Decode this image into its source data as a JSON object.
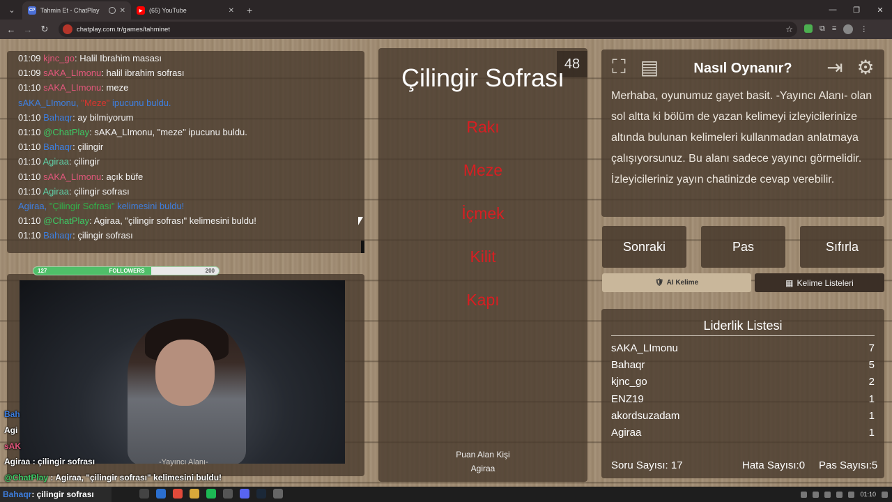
{
  "browser": {
    "tabs": [
      {
        "label": "Tahmin Et - ChatPlay",
        "favicon": "CP"
      },
      {
        "label": "(65) YouTube",
        "favicon": "yt"
      }
    ],
    "url": "chatplay.com.tr/games/tahminet"
  },
  "chat": {
    "lines": [
      {
        "time": "01:09",
        "user": "kjnc_go",
        "user_color": "#e0577b",
        "text": "Halil Ibrahim masası"
      },
      {
        "time": "01:09",
        "user": "sAKA_LImonu",
        "user_color": "#e0577b",
        "text": "halil ibrahim sofrası"
      },
      {
        "time": "01:10",
        "user": "sAKA_LImonu",
        "user_color": "#e0577b",
        "text": "meze"
      },
      {
        "system": true,
        "pre": "sAKA_LImonu, ",
        "quote": "\"Meze\"",
        "post": " ipucunu buldu."
      },
      {
        "time": "01:10",
        "user": "Bahaqr",
        "user_color": "#3e7fe0",
        "text": "ay bilmiyorum"
      },
      {
        "time": "01:10",
        "user": "@ChatPlay",
        "user_color": "#3ccb65",
        "text": "sAKA_LImonu, \"meze\" ipucunu buldu."
      },
      {
        "time": "01:10",
        "user": "Bahaqr",
        "user_color": "#3e7fe0",
        "text": "çilingir"
      },
      {
        "time": "01:10",
        "user": "Agiraa",
        "user_color": "#5fd0a8",
        "text": "çilingir"
      },
      {
        "time": "01:10",
        "user": "sAKA_LImonu",
        "user_color": "#e0577b",
        "text": "açık büfe"
      },
      {
        "time": "01:10",
        "user": "Agiraa",
        "user_color": "#5fd0a8",
        "text": "çilingir sofrası"
      },
      {
        "system": true,
        "green": true,
        "pre": "Agiraa, ",
        "quote": "\"Çilingir Sofrası\"",
        "post": " kelimesini buldu!"
      },
      {
        "time": "01:10",
        "user": "@ChatPlay",
        "user_color": "#3ccb65",
        "text": "Agiraa, \"çilingir sofrası\" kelimesini buldu!"
      },
      {
        "time": "01:10",
        "user": "Bahaqr",
        "user_color": "#3e7fe0",
        "text": "çilingir sofrası"
      }
    ]
  },
  "followers": {
    "current": "127",
    "label": "FOLLOWERS",
    "goal": "200",
    "progress": 0.635
  },
  "stream_overlay": {
    "chat": [
      {
        "user": "Bah",
        "color": "#3e7fe0",
        "text": ""
      },
      {
        "user": "Agi",
        "color": "#ffffff",
        "text": ""
      },
      {
        "user": "sAK",
        "color": "#e0577b",
        "text": ""
      },
      {
        "user": "Agiraa",
        "color": "#ffffff",
        "text": " : çilingir sofrası"
      },
      {
        "user": "@ChatPlay",
        "color": "#3ccb65",
        "text": " : Agiraa, \"çilingir sofrası\" kelimesini buldu!"
      },
      {
        "user": "Bahaqr",
        "color": "#3e7fe0",
        "text": " : çilingir sofrası"
      }
    ],
    "yayinci_label": "-Yayıncı Alanı-"
  },
  "game": {
    "word": "Çilingir Sofrası",
    "timer": "48",
    "taboo_words": [
      "Rakı",
      "Meze",
      "İçmek",
      "Kilit",
      "Kapı"
    ],
    "taboo_color": "#d81e22",
    "scorer_label": "Puan Alan Kişi",
    "scorer_name": "Agiraa"
  },
  "howto": {
    "title": "Nasıl Oynanır?",
    "text": "Merhaba, oyunumuz gayet basit. -Yayıncı Alanı- olan sol altta ki bölüm de yazan kelimeyi izleyicilerinize altında bulunan kelimeleri kullanmadan anlatmaya çalışıyorsunuz. Bu alanı sadece yayıncı görmelidir. İzleyicileriniz yayın chatinizde cevap verebilir."
  },
  "buttons": {
    "next": "Sonraki",
    "pass": "Pas",
    "reset": "Sıfırla",
    "ai_word": "AI Kelime",
    "word_lists": "Kelime Listeleri"
  },
  "leaderboard": {
    "title": "Liderlik Listesi",
    "rows": [
      {
        "name": "sAKA_LImonu",
        "score": "7"
      },
      {
        "name": "Bahaqr",
        "score": "5"
      },
      {
        "name": "kjnc_go",
        "score": "2"
      },
      {
        "name": "ENZ19",
        "score": "1"
      },
      {
        "name": "akordsuzadam",
        "score": "1"
      },
      {
        "name": "Agiraa",
        "score": "1"
      }
    ],
    "question_count_label": "Soru Sayısı:",
    "question_count": "17",
    "error_count_label": "Hata Sayısı:",
    "error_count": "0",
    "pass_count_label": "Pas Sayısı:",
    "pass_count": "5"
  },
  "taskbar": {
    "clock": "01:10"
  }
}
